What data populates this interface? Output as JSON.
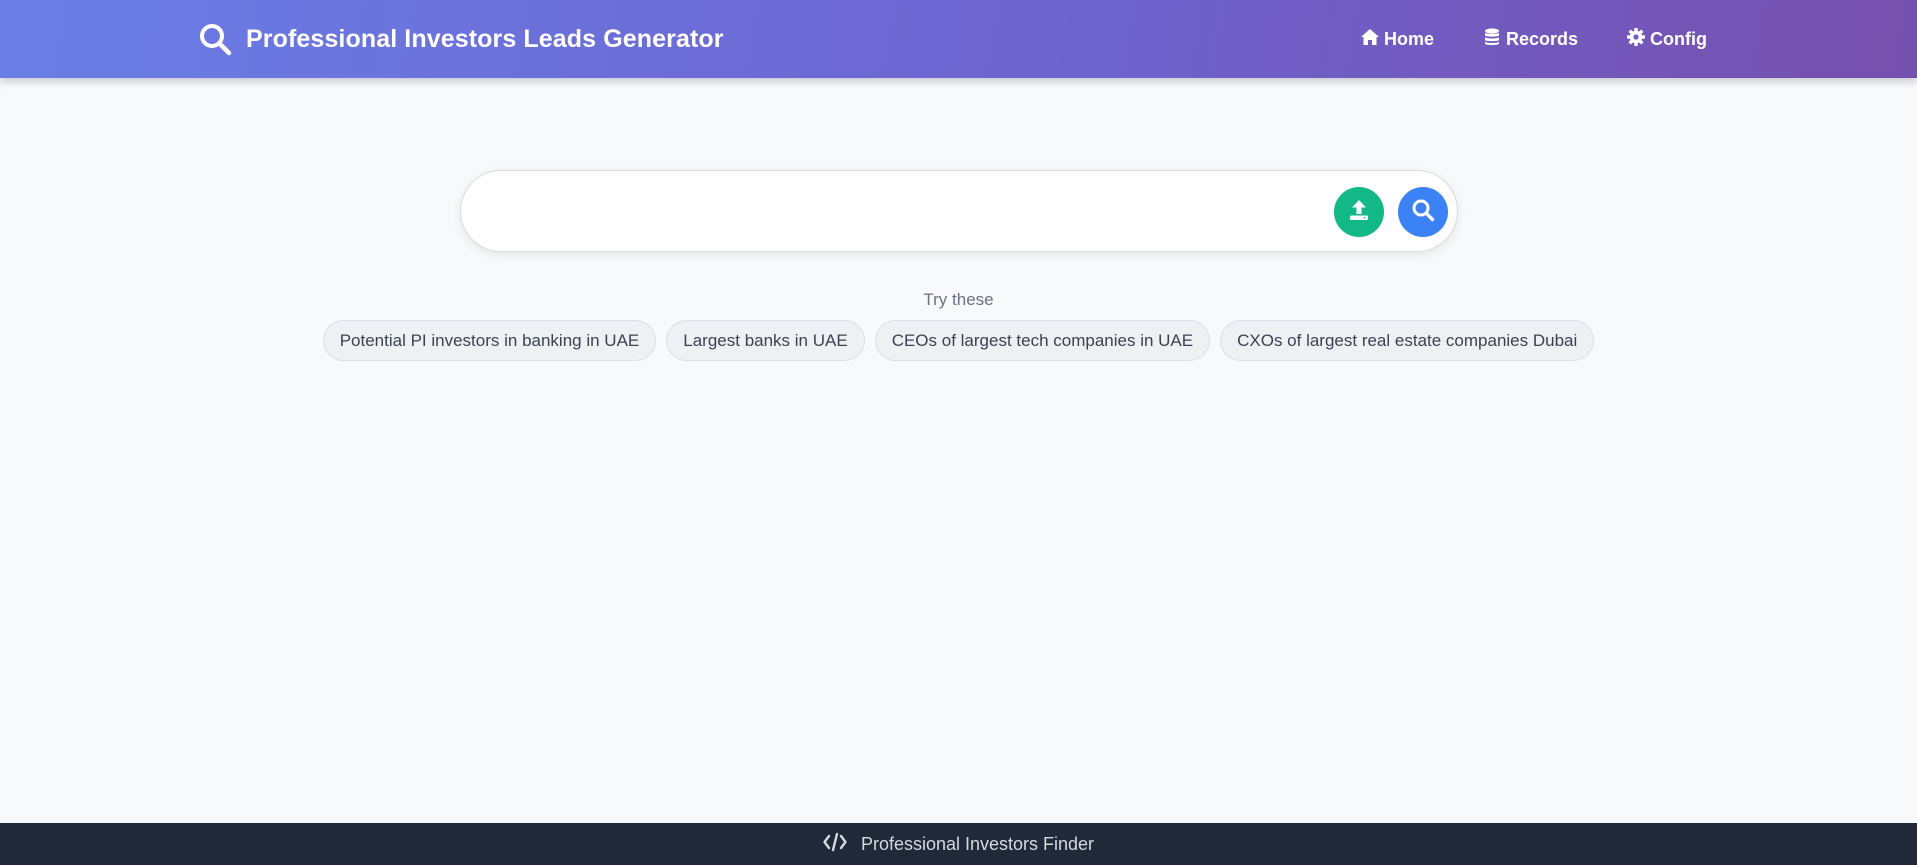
{
  "header": {
    "title": "Professional Investors Leads Generator",
    "brand_icon": "search-icon",
    "nav": [
      {
        "label": "Home",
        "icon": "home-icon"
      },
      {
        "label": "Records",
        "icon": "database-icon"
      },
      {
        "label": "Config",
        "icon": "gear-icon"
      }
    ]
  },
  "search": {
    "value": "",
    "placeholder": "",
    "upload_icon": "upload-icon",
    "search_icon": "search-icon"
  },
  "suggestions": {
    "label": "Try these",
    "items": [
      "Potential PI investors in banking in UAE",
      "Largest banks in UAE",
      "CEOs of largest tech companies in UAE",
      "CXOs of largest real estate companies Dubai"
    ]
  },
  "footer": {
    "icon": "code-icon",
    "text": "Professional Investors Finder"
  },
  "colors": {
    "header_gradient_start": "#6a7ee6",
    "header_gradient_end": "#7650ad",
    "upload_button": "#12b886",
    "search_button": "#3b82f6",
    "footer_bg": "#1f2937",
    "page_bg": "#f8f9fb"
  }
}
